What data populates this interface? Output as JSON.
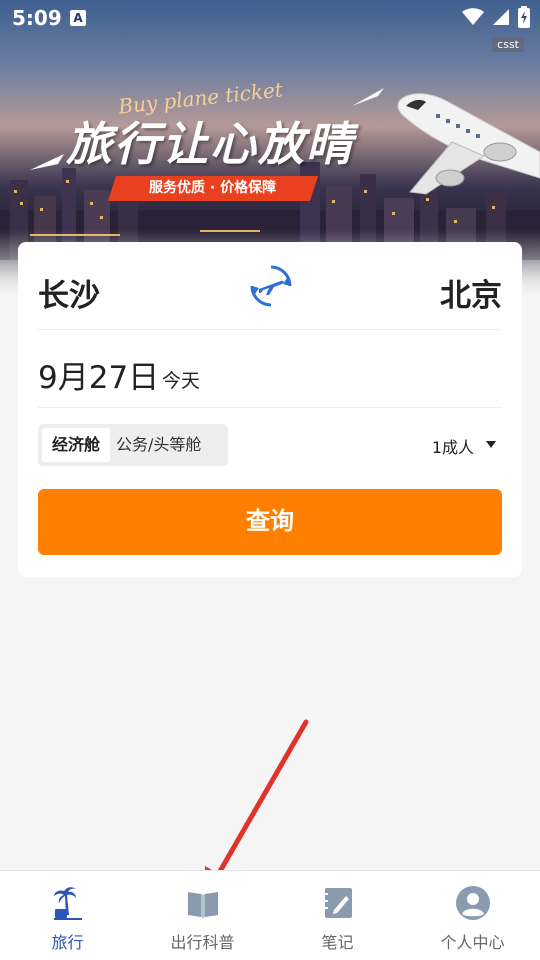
{
  "status_bar": {
    "time": "5:09",
    "notification_icon": "A",
    "icons": [
      "wifi-icon",
      "signal-icon",
      "battery-charging-icon"
    ]
  },
  "banner": {
    "badge": "csst",
    "script_text": "Buy plane ticket",
    "slogan": "旅行让心放晴",
    "tagline": "服务优质 · 价格保障"
  },
  "search": {
    "from_city": "长沙",
    "to_city": "北京",
    "swap_icon": "plane-swap-icon",
    "date": "9月27日",
    "date_sub": "今天",
    "cabin_selected": "经济舱",
    "cabin_other": "公务/头等舱",
    "passengers": "1成人",
    "query_button": "查询"
  },
  "colors": {
    "accent": "#ff8000",
    "primary": "#2c55b8",
    "tagline_bg": "#e9401f",
    "annotation_arrow": "#e0342b"
  },
  "tabs": [
    {
      "label": "旅行",
      "icon": "palm-tree-suitcase-icon",
      "active": true
    },
    {
      "label": "出行科普",
      "icon": "book-icon",
      "active": false
    },
    {
      "label": "笔记",
      "icon": "notebook-pen-icon",
      "active": false
    },
    {
      "label": "个人中心",
      "icon": "user-icon",
      "active": false
    }
  ]
}
